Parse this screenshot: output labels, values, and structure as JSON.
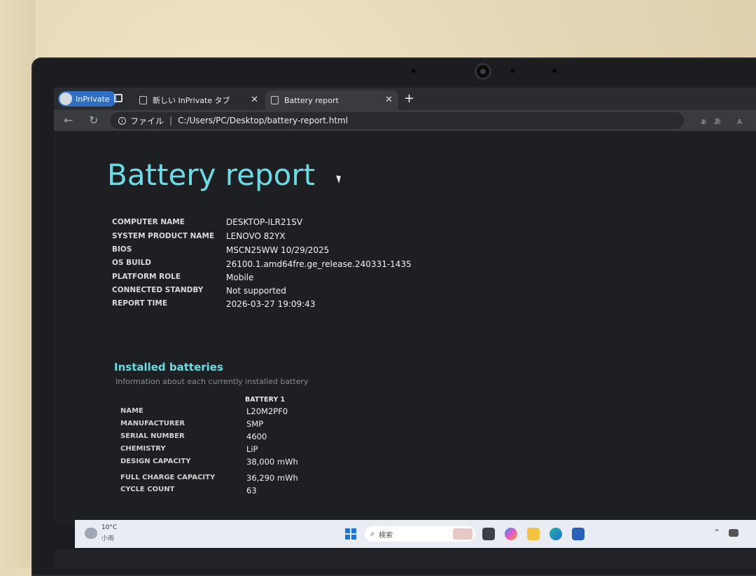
{
  "browser": {
    "inprivate_label": "InPrivate",
    "tabs": [
      {
        "label": "新しい InPrivate タブ",
        "active": false
      },
      {
        "label": "Battery report",
        "active": true
      }
    ],
    "close_glyph": "✕",
    "new_tab_glyph": "+",
    "address": {
      "scheme_label": "ファイル",
      "separator": "|",
      "path": "C:/Users/PC/Desktop/battery-report.html"
    },
    "right_icons": "ぁあ A"
  },
  "report": {
    "title": "Battery report",
    "system": [
      {
        "key": "COMPUTER NAME",
        "value": "DESKTOP-ILR21SV"
      },
      {
        "key": "SYSTEM PRODUCT NAME",
        "value": "LENOVO 82YX"
      },
      {
        "key": "BIOS",
        "value": "MSCN25WW 10/29/2025"
      },
      {
        "key": "OS BUILD",
        "value": "26100.1.amd64fre.ge_release.240331-1435"
      },
      {
        "key": "PLATFORM ROLE",
        "value": "Mobile"
      },
      {
        "key": "CONNECTED STANDBY",
        "value": "Not supported"
      },
      {
        "key": "REPORT TIME",
        "value": "2026-03-27  19:09:43"
      }
    ],
    "installed": {
      "heading": "Installed batteries",
      "subheading": "Information about each currently installed battery",
      "column": "BATTERY 1",
      "rows": [
        {
          "key": "NAME",
          "value": "L20M2PF0"
        },
        {
          "key": "MANUFACTURER",
          "value": "SMP"
        },
        {
          "key": "SERIAL NUMBER",
          "value": "4600"
        },
        {
          "key": "CHEMISTRY",
          "value": "LiP"
        },
        {
          "key": "DESIGN CAPACITY",
          "value": "38,000 mWh"
        },
        {
          "key": "FULL CHARGE CAPACITY",
          "value": "36,290 mWh"
        },
        {
          "key": "CYCLE COUNT",
          "value": "63"
        }
      ]
    }
  },
  "taskbar": {
    "weather_temp": "10°C",
    "weather_desc": "小雨",
    "search_placeholder": "検索",
    "apps": [
      "task-view-icon",
      "copilot-icon",
      "file-explorer-icon",
      "edge-icon",
      "store-icon"
    ]
  },
  "colors": {
    "accent": "#6cdbe6",
    "page_bg": "#1e1f23",
    "inprivate": "#2f6ec2"
  }
}
